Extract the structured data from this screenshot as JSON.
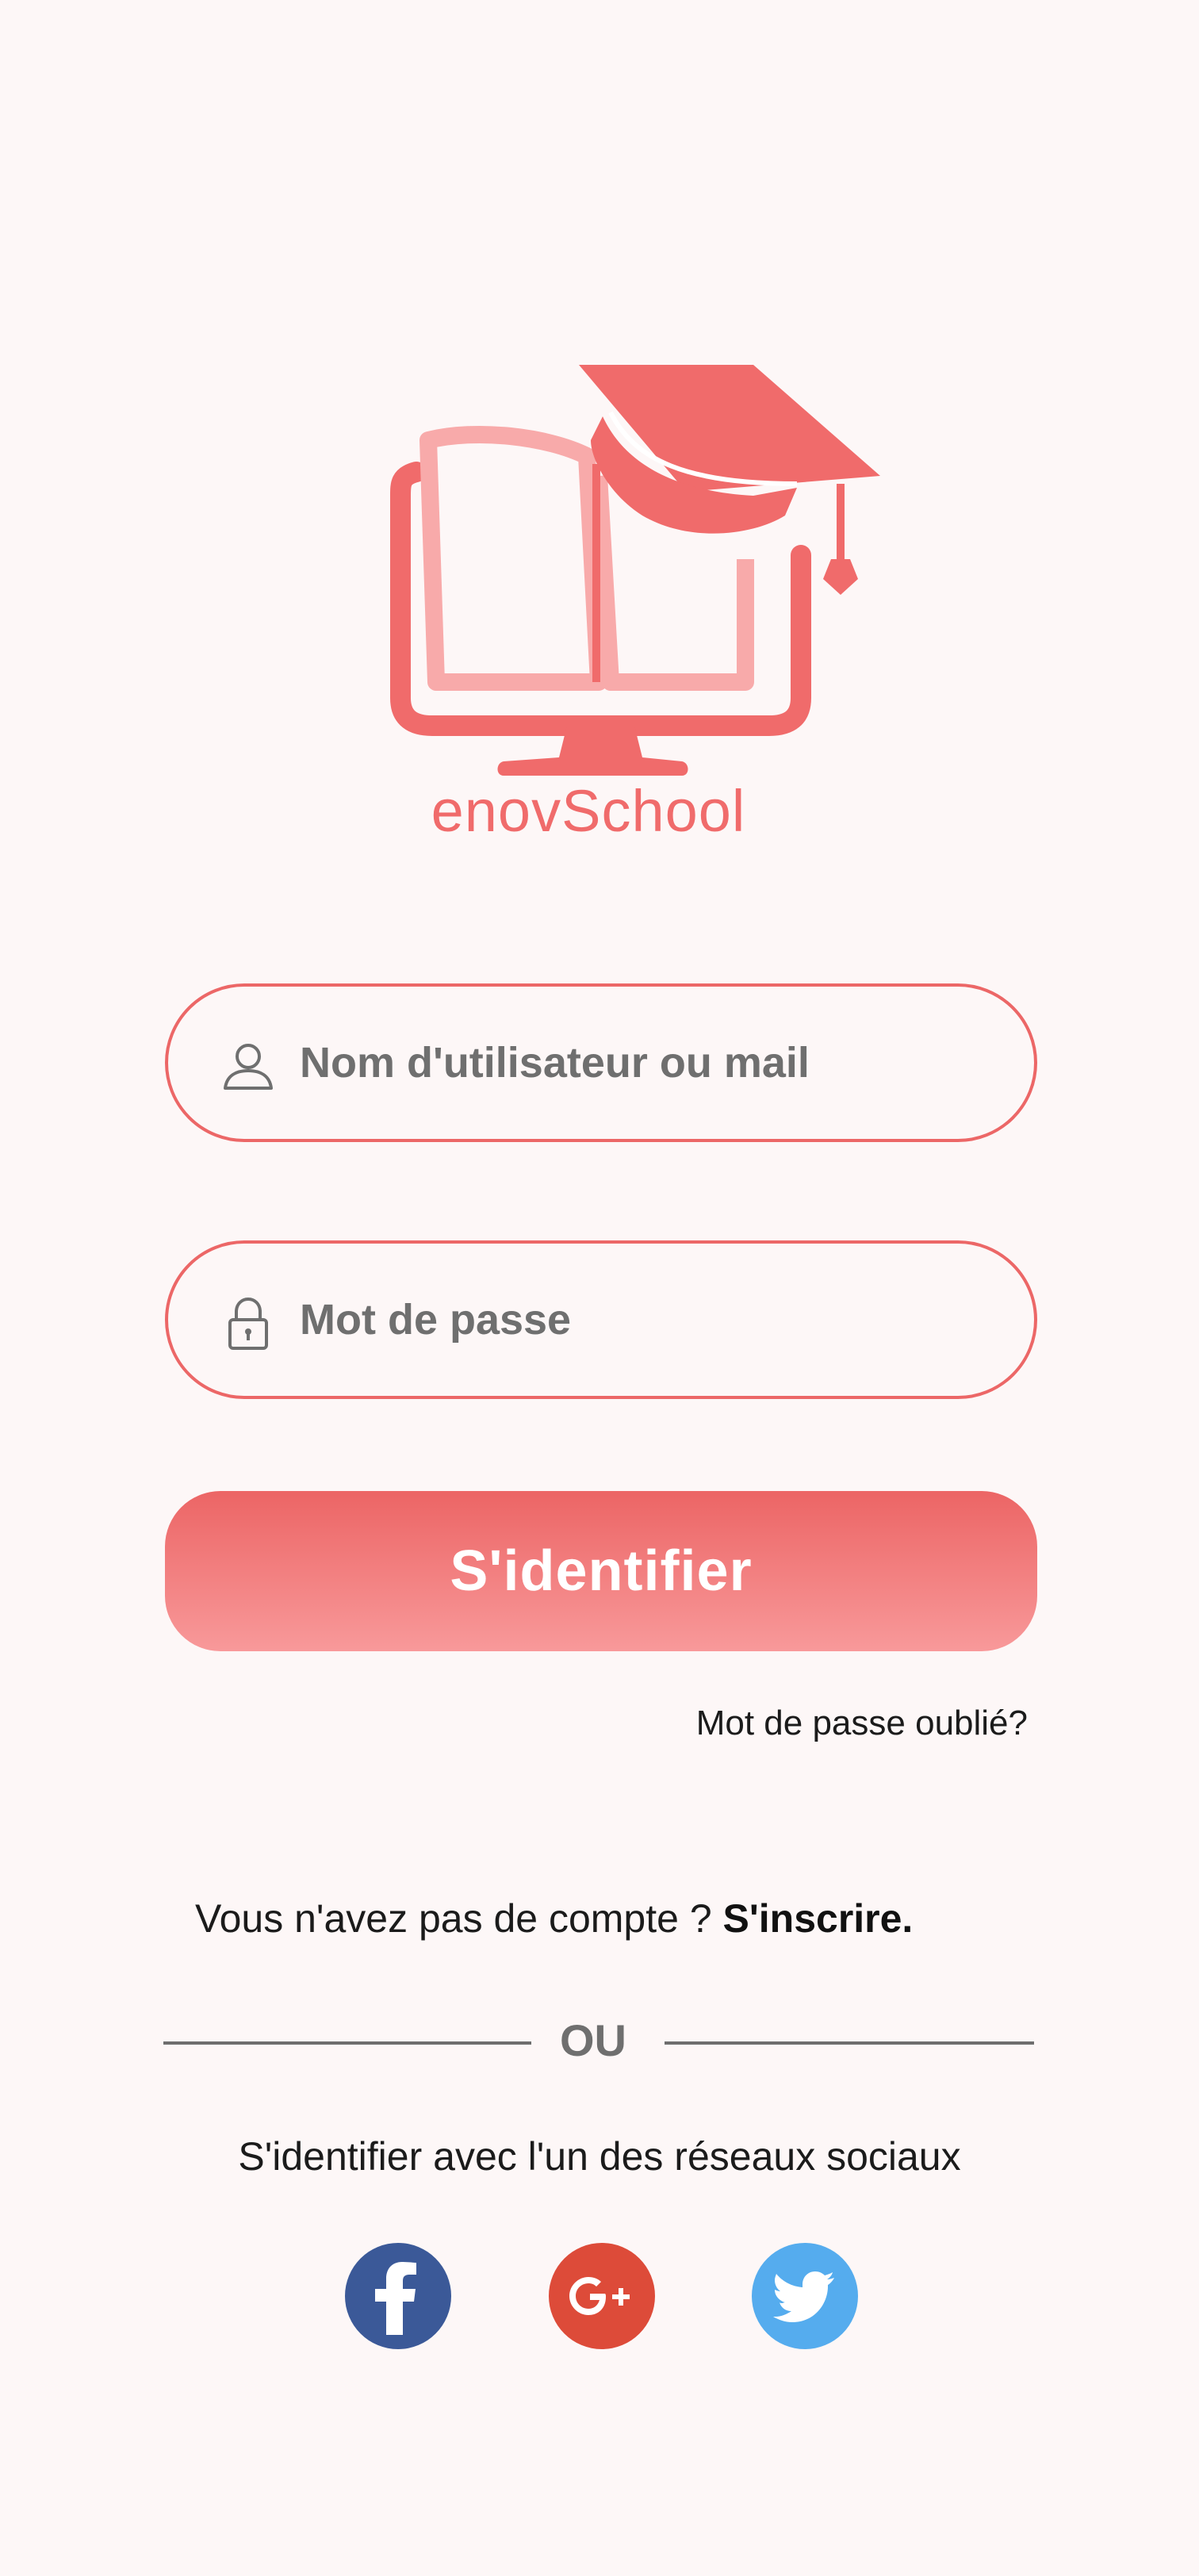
{
  "brand": {
    "name": "enovSchool",
    "color": "#f06b6b"
  },
  "login_form": {
    "username_placeholder": "Nom d'utilisateur ou mail",
    "password_placeholder": "Mot de passe",
    "submit_label": "S'identifier",
    "forgot_password": "Mot de passe oublié?"
  },
  "signup": {
    "prompt": "Vous n'avez pas de compte ? ",
    "link": "S'inscrire."
  },
  "divider": {
    "label": "OU"
  },
  "social": {
    "caption": "S'identifier avec l'un des réseaux sociaux",
    "buttons": [
      {
        "icon": "facebook-icon",
        "color": "#3b5998"
      },
      {
        "icon": "google-plus-icon",
        "color": "#dd4b39"
      },
      {
        "icon": "twitter-icon",
        "color": "#55acee"
      }
    ]
  },
  "colors": {
    "accent": "#ec6767",
    "background": "#fdf7f7"
  }
}
